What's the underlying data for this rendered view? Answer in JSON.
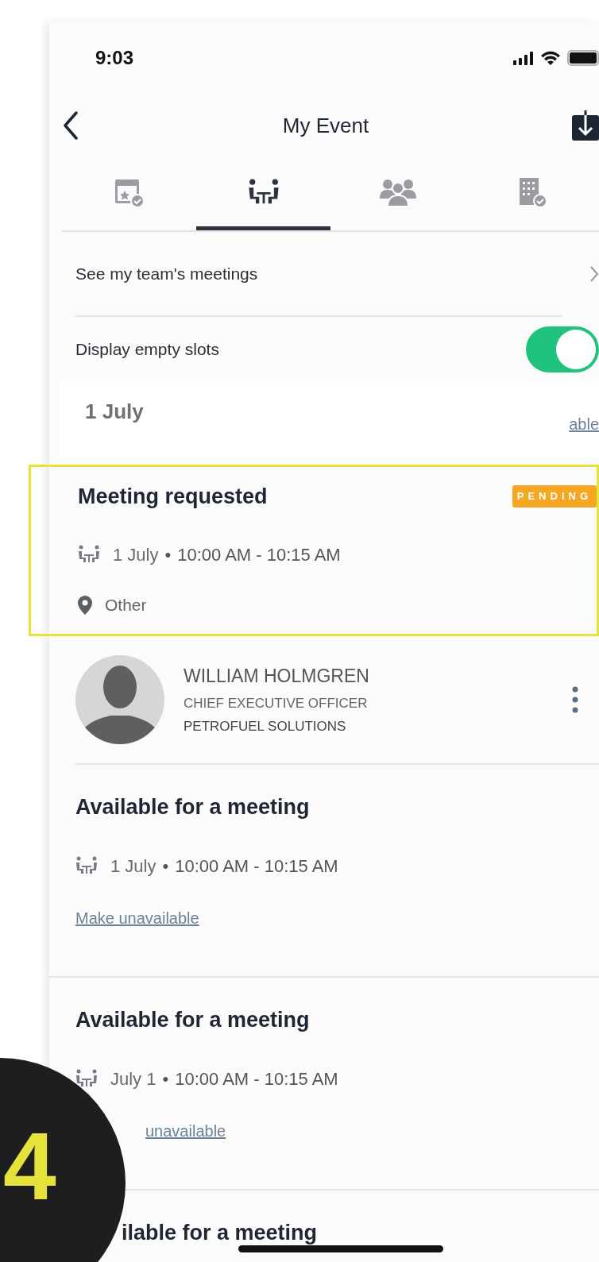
{
  "status_bar": {
    "time": "9:03"
  },
  "header": {
    "title": "My Event"
  },
  "tabs": [
    {
      "kind": "calendar",
      "selected": false
    },
    {
      "kind": "meeting",
      "selected": true
    },
    {
      "kind": "people",
      "selected": false
    },
    {
      "kind": "building",
      "selected": false
    }
  ],
  "team_link": {
    "label": "See my team's meetings"
  },
  "empty_slots": {
    "label": "Display empty slots",
    "on": true
  },
  "day": {
    "date": "1 July",
    "link": "able"
  },
  "slots": [
    {
      "kind": "request",
      "highlighted": true,
      "title": "Meeting requested",
      "badge": "PENDING",
      "date": "1 July",
      "separator": "•",
      "time": "10:00 AM - 10:15 AM",
      "location": "Other",
      "person": {
        "name": "WILLIAM HOLMGREN",
        "role": "CHIEF EXECUTIVE OFFICER",
        "company": "PETROFUEL SOLUTIONS"
      }
    },
    {
      "kind": "available",
      "title": "Available for a meeting",
      "date": "1 July",
      "separator": "•",
      "time": "10:00 AM - 10:15 AM",
      "link": "Make unavailable"
    },
    {
      "kind": "available",
      "title": "Available for a meeting",
      "date": "July 1",
      "separator": "•",
      "time": "10:00 AM - 10:15 AM",
      "link": "unavailable"
    },
    {
      "kind": "available",
      "title": "ilable for a meeting"
    }
  ],
  "step_badge": {
    "label": "4"
  }
}
